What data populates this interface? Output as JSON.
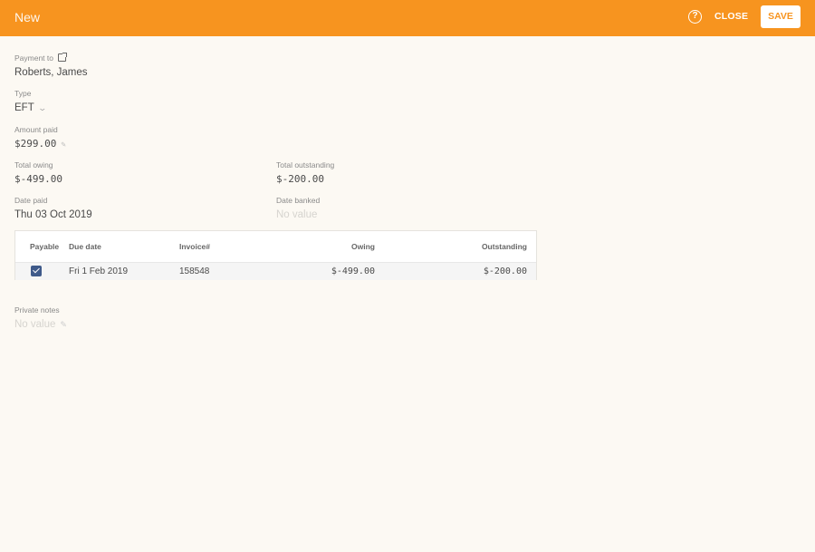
{
  "header": {
    "title": "New",
    "help_icon": "?",
    "close_label": "CLOSE",
    "save_label": "SAVE"
  },
  "form": {
    "payment_to": {
      "label": "Payment to",
      "value": "Roberts, James"
    },
    "type": {
      "label": "Type",
      "value": "EFT"
    },
    "amount_paid": {
      "label": "Amount paid",
      "value": "$299.00"
    },
    "total_owing": {
      "label": "Total owing",
      "value": "$-499.00"
    },
    "total_outstanding": {
      "label": "Total outstanding",
      "value": "$-200.00"
    },
    "date_paid": {
      "label": "Date paid",
      "value": "Thu 03 Oct 2019"
    },
    "date_banked": {
      "label": "Date banked",
      "value": "No value"
    },
    "private_notes": {
      "label": "Private notes",
      "value": "No value"
    }
  },
  "table": {
    "headers": [
      "Payable",
      "Due date",
      "Invoice#",
      "Owing",
      "Outstanding"
    ],
    "rows": [
      {
        "payable": true,
        "due_date": "Fri 1 Feb 2019",
        "invoice": "158548",
        "owing": "$-499.00",
        "outstanding": "$-200.00"
      }
    ]
  },
  "icons": {
    "pencil": "✎",
    "chevron": "⌄"
  }
}
